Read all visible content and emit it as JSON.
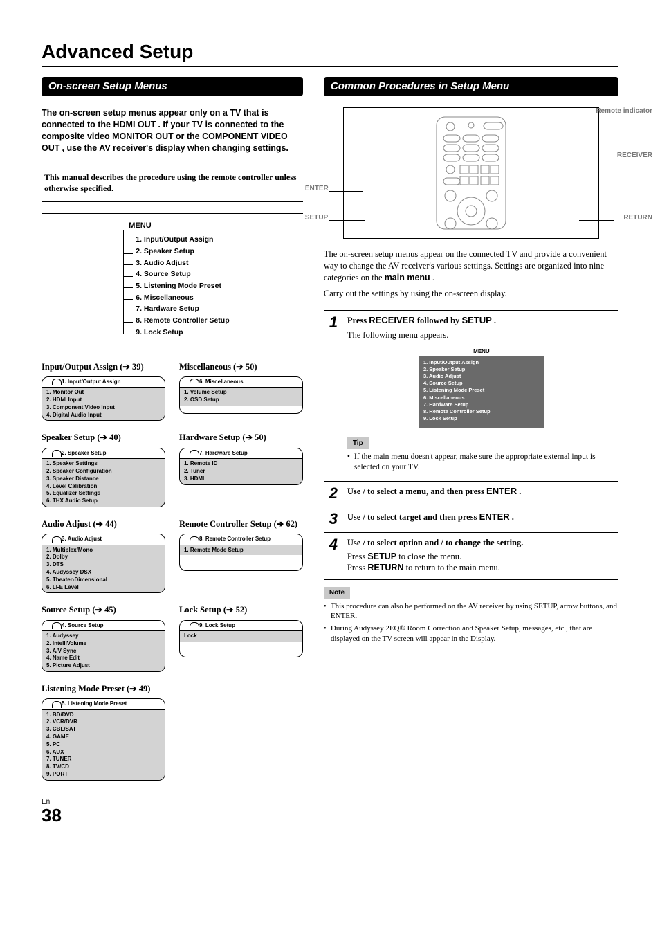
{
  "page": {
    "title": "Advanced Setup",
    "lang_label": "En",
    "number": "38"
  },
  "left": {
    "section_title": "On-screen Setup Menus",
    "intro": {
      "pre": "The on-screen setup menus appear only on a TV that is connected to the ",
      "b1": "HDMI OUT",
      "mid1": ". If your TV is connected to the composite video ",
      "b2": "MONITOR OUT",
      "mid2": " or the ",
      "b3": "COMPONENT VIDEO OUT",
      "mid3": ", use the AV receiver's display when changing settings."
    },
    "box_line": "This manual describes the procedure using the remote controller unless otherwise specified.",
    "tree": {
      "title": "MENU",
      "items": [
        "1. Input/Output Assign",
        "2. Speaker Setup",
        "3. Audio Adjust",
        "4. Source Setup",
        "5. Listening Mode Preset",
        "6. Miscellaneous",
        "7. Hardware Setup",
        "8. Remote Controller Setup",
        "9. Lock Setup"
      ]
    },
    "panels": [
      {
        "slot": "L",
        "head": "Input/Output Assign (➔ 39)",
        "title": "1.   Input/Output Assign",
        "items": [
          "1.  Monitor Out",
          "2.  HDMI Input",
          "3.  Component Video Input",
          "4.  Digital Audio Input"
        ]
      },
      {
        "slot": "R",
        "head": "Miscellaneous (➔ 50)",
        "title": "6.   Miscellaneous",
        "items": [
          "1.  Volume Setup",
          "2.  OSD Setup"
        ]
      },
      {
        "slot": "L",
        "head": "Speaker Setup (➔ 40)",
        "title": "2.   Speaker Setup",
        "items": [
          "1.  Speaker Settings",
          "2.  Speaker Configuration",
          "3.  Speaker Distance",
          "4.  Level Calibration",
          "5.  Equalizer Settings",
          "6.  THX Audio Setup"
        ]
      },
      {
        "slot": "R",
        "head": "Hardware Setup (➔ 50)",
        "title": "7.   Hardware Setup",
        "items": [
          "1.  Remote ID",
          "2.  Tuner",
          "3.  HDMI"
        ]
      },
      {
        "slot": "L",
        "head": "Audio Adjust (➔ 44)",
        "title": "3.   Audio Adjust",
        "items": [
          "1.  Multiplex/Mono",
          "2.  Dolby",
          "3.  DTS",
          "4.  Audyssey DSX",
          "5.  Theater-Dimensional",
          "6.  LFE Level"
        ]
      },
      {
        "slot": "R",
        "head": "Remote Controller Setup (➔ 62)",
        "title": "8.   Remote Controller Setup",
        "items": [
          "1.  Remote Mode Setup"
        ]
      },
      {
        "slot": "L",
        "head": "Source Setup (➔ 45)",
        "title": "4.   Source Setup",
        "items": [
          "1.  Audyssey",
          "2.  IntelliVolume",
          "3.  A/V Sync",
          "4.  Name Edit",
          "5.  Picture Adjust"
        ]
      },
      {
        "slot": "R",
        "head": "Lock Setup (➔ 52)",
        "title": "9.   Lock Setup",
        "items": [
          "Lock"
        ]
      },
      {
        "slot": "L",
        "head": "Listening Mode Preset (➔ 49)",
        "title": "5.   Listening Mode Preset",
        "items": [
          "1.  BD/DVD",
          "2.  VCR/DVR",
          "3.  CBL/SAT",
          "4.  GAME",
          "5.  PC",
          "6.  AUX",
          "7.  TUNER",
          "8.  TV/CD",
          "9.  PORT"
        ]
      }
    ]
  },
  "right": {
    "section_title": "Common Procedures in Setup Menu",
    "labels": {
      "remote_indicator": "Remote indicator",
      "receiver": "RECEIVER",
      "enter": "ENTER",
      "setup": "SETUP",
      "return": "RETURN"
    },
    "para1_pre": "The on-screen setup menus appear on the connected TV and provide a convenient way to change the AV receiver's various settings. Settings are organized into nine categories on the ",
    "para1_b": "main menu",
    "para1_post": ".",
    "para2": "Carry out the settings by using the on-screen display.",
    "steps": [
      {
        "no": "1",
        "line1_pre": "Press ",
        "line1_b1": "RECEIVER",
        "line1_mid": " followed by ",
        "line1_b2": "SETUP",
        "line1_post": ".",
        "line2": "The following menu appears.",
        "screen_title": "MENU",
        "screen_items": [
          "1. Input/Output Assign",
          "2. Speaker Setup",
          "3. Audio Adjust",
          "4. Source Setup",
          "5. Listening Mode Preset",
          "6. Miscellaneous",
          "7. Hardware Setup",
          "8. Remote Controller Setup",
          "9. Lock Setup"
        ],
        "tip_label": "Tip",
        "tip_text": "If the main menu doesn't appear, make sure the appropriate external input is selected on your TV."
      },
      {
        "no": "2",
        "text_pre": "Use    /  to select a menu, and then press ",
        "text_b": "ENTER",
        "text_post": "."
      },
      {
        "no": "3",
        "text_pre": "Use    /  to select target and then press ",
        "text_b": "ENTER",
        "text_post": "."
      },
      {
        "no": "4",
        "line1": "Use    /  to select option and    /  to change the setting.",
        "line2_pre": "Press ",
        "line2_b": "SETUP",
        "line2_post": " to close the menu.",
        "line3_pre": "Press ",
        "line3_b": "RETURN",
        "line3_post": " to return to the main menu."
      }
    ],
    "note_label": "Note",
    "notes": [
      "This procedure can also be performed on the AV receiver by using SETUP, arrow buttons, and ENTER.",
      "During Audyssey 2EQ® Room Correction and Speaker Setup, messages, etc., that are displayed on the TV screen will appear in the Display."
    ]
  }
}
